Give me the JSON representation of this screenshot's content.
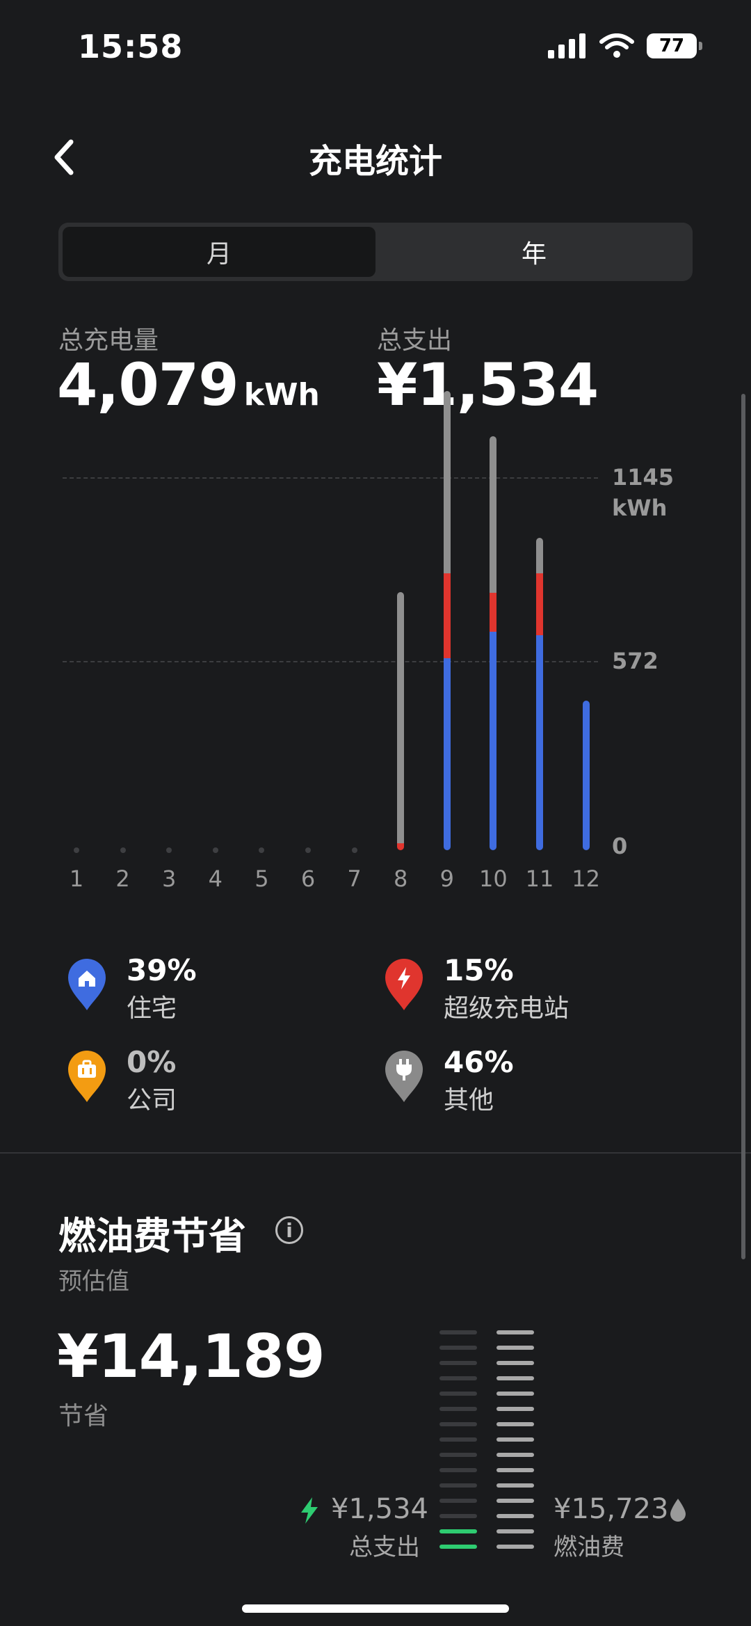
{
  "status": {
    "time": "15:58",
    "battery": "77"
  },
  "header": {
    "title": "充电统计"
  },
  "tabs": {
    "month": "月",
    "year": "年"
  },
  "totals": {
    "energy_label": "总充电量",
    "energy_value": "4,079",
    "energy_unit": "kWh",
    "cost_label": "总支出",
    "cost_value": "¥1,534"
  },
  "chart_data": {
    "type": "bar",
    "stacked": true,
    "categories": [
      "1",
      "2",
      "3",
      "4",
      "5",
      "6",
      "7",
      "8",
      "9",
      "10",
      "11",
      "12"
    ],
    "series": [
      {
        "name": "住宅",
        "color": "#3f6ce0",
        "values": [
          0,
          0,
          0,
          0,
          0,
          0,
          0,
          0,
          590,
          670,
          660,
          460
        ]
      },
      {
        "name": "超级充电站",
        "color": "#e0352e",
        "values": [
          0,
          0,
          0,
          0,
          0,
          0,
          0,
          22,
          260,
          120,
          190,
          0
        ]
      },
      {
        "name": "其他",
        "color": "#8f8f8f",
        "values": [
          0,
          0,
          0,
          0,
          0,
          0,
          0,
          770,
          560,
          480,
          110,
          0
        ]
      }
    ],
    "ylim": [
      0,
      1145
    ],
    "y_ticks": [
      "0",
      "572",
      "1145"
    ],
    "y_unit": "kWh",
    "grid": true
  },
  "legend": [
    {
      "pct": "39%",
      "name": "住宅",
      "icon": "home-icon",
      "color": "#3f6ce0"
    },
    {
      "pct": "15%",
      "name": "超级充电站",
      "icon": "bolt-icon",
      "color": "#e0352e"
    },
    {
      "pct": "0%",
      "name": "公司",
      "icon": "briefcase-icon",
      "color": "#f39c12"
    },
    {
      "pct": "46%",
      "name": "其他",
      "icon": "plug-icon",
      "color": "#8a8a8a"
    }
  ],
  "fuel": {
    "title": "燃油费节省",
    "estimate_label": "预估值",
    "saving_value": "¥14,189",
    "saving_label": "节省",
    "spend_value": "¥1,534",
    "spend_label": "总支出",
    "fuel_value": "¥15,723",
    "fuel_label": "燃油费",
    "spend_fraction": 0.1
  }
}
